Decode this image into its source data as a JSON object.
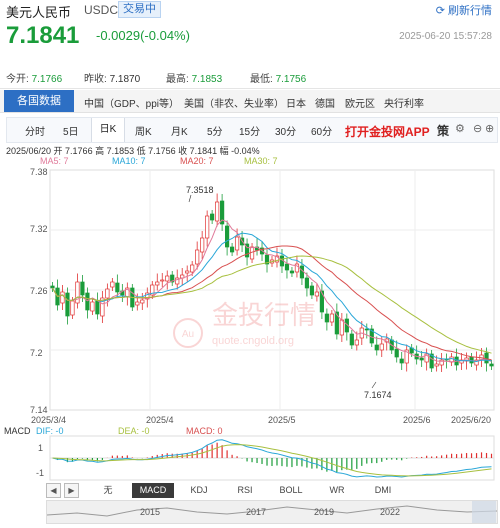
{
  "header": {
    "title": "美元人民币",
    "symbol": "USDCNY",
    "status_badge": "交易中",
    "refresh_label": "刷新行情",
    "price": "7.1841",
    "change": "-0.0029(-0.04%)",
    "timestamp": "2025-06-20 15:57:28"
  },
  "stats": [
    {
      "label": "今开:",
      "value": "7.1766"
    },
    {
      "label": "昨收:",
      "value": "7.1870"
    },
    {
      "label": "最高:",
      "value": "7.1853"
    },
    {
      "label": "最低:",
      "value": "7.1756"
    }
  ],
  "categories": {
    "active": "各国数据",
    "items": [
      "中国（GDP、ppi等）",
      "美国（非农、失业率）",
      "日本",
      "德国",
      "欧元区",
      "央行利率"
    ]
  },
  "periods": {
    "items": [
      "分时",
      "5日",
      "日K",
      "周K",
      "月K",
      "5分",
      "15分",
      "30分",
      "60分"
    ],
    "active": "日K",
    "app_link": "打开金投网APP",
    "extra": "策"
  },
  "chart_info": {
    "ohlc_line": "2025/06/20  开 7.1766  高 7.1853  低 7.1756  收 7.1841  幅 -0.04%",
    "ma5": "MA5: 7",
    "ma10": "MA10: 7",
    "ma20": "MA20: 7",
    "ma30": "MA30: 7",
    "high_label": "7.3518",
    "low_label": "7.1674",
    "watermark_brand": "金投行情",
    "watermark_url": "quote.cngold.org"
  },
  "macd_legend": {
    "title": "MACD",
    "dif": "DIF: -0",
    "dea": "DEA: -0",
    "macd": "MACD: 0"
  },
  "indicators": {
    "items": [
      "无",
      "MACD",
      "KDJ",
      "RSI",
      "BOLL",
      "WR",
      "DMI"
    ],
    "active": "MACD"
  },
  "overview_years": [
    "2015",
    "2017",
    "2019",
    "2022"
  ],
  "colors": {
    "up": "#e03030",
    "down": "#1a9c3a",
    "ma5": "#e07a9a",
    "ma10": "#2aa7d8",
    "ma20": "#d85050",
    "ma30": "#a8c040",
    "accent": "#2d6fc4"
  },
  "chart_data": {
    "type": "candlestick",
    "y_axis_ticks": [
      "7.38",
      "7.32",
      "7.26",
      "7.2",
      "7.14"
    ],
    "ylim": [
      7.14,
      7.38
    ],
    "x_axis_ticks": [
      "2025/3/4",
      "2025/4",
      "2025/5",
      "2025/6",
      "2025/6/20"
    ],
    "macd_axis_ticks": [
      "1",
      "-1"
    ],
    "closes": [
      7.262,
      7.245,
      7.258,
      7.234,
      7.249,
      7.268,
      7.255,
      7.24,
      7.248,
      7.236,
      7.252,
      7.261,
      7.268,
      7.258,
      7.255,
      7.262,
      7.243,
      7.248,
      7.25,
      7.257,
      7.265,
      7.268,
      7.27,
      7.274,
      7.268,
      7.272,
      7.275,
      7.279,
      7.285,
      7.3,
      7.312,
      7.334,
      7.33,
      7.348,
      7.326,
      7.303,
      7.298,
      7.313,
      7.305,
      7.293,
      7.303,
      7.3,
      7.296,
      7.286,
      7.29,
      7.294,
      7.284,
      7.28,
      7.277,
      7.286,
      7.272,
      7.262,
      7.255,
      7.258,
      7.238,
      7.228,
      7.236,
      7.216,
      7.23,
      7.218,
      7.205,
      7.21,
      7.222,
      7.22,
      7.207,
      7.2,
      7.206,
      7.211,
      7.2,
      7.193,
      7.187,
      7.2,
      7.197,
      7.191,
      7.19,
      7.196,
      7.182,
      7.186,
      7.19,
      7.19,
      7.193,
      7.185,
      7.19,
      7.192,
      7.187,
      7.19,
      7.195,
      7.187,
      7.184
    ]
  }
}
